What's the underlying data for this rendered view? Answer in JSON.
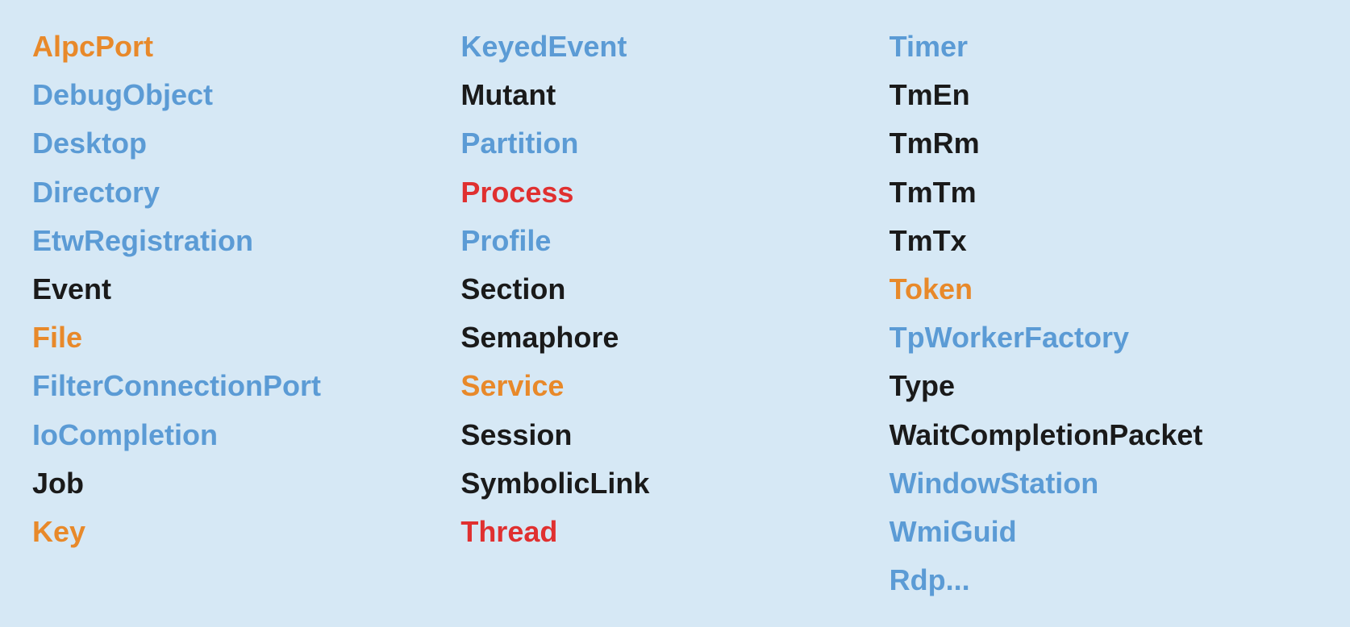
{
  "columns": [
    {
      "id": "col1",
      "items": [
        {
          "label": "AlpcPort",
          "color": "orange"
        },
        {
          "label": "DebugObject",
          "color": "blue"
        },
        {
          "label": "Desktop",
          "color": "blue"
        },
        {
          "label": "Directory",
          "color": "blue"
        },
        {
          "label": "EtwRegistration",
          "color": "blue"
        },
        {
          "label": "Event",
          "color": "black"
        },
        {
          "label": "File",
          "color": "orange"
        },
        {
          "label": "FilterConnectionPort",
          "color": "blue"
        },
        {
          "label": "IoCompletion",
          "color": "blue"
        },
        {
          "label": "Job",
          "color": "black"
        },
        {
          "label": "Key",
          "color": "orange"
        }
      ]
    },
    {
      "id": "col2",
      "items": [
        {
          "label": "KeyedEvent",
          "color": "blue"
        },
        {
          "label": "Mutant",
          "color": "black"
        },
        {
          "label": "Partition",
          "color": "blue"
        },
        {
          "label": "Process",
          "color": "red"
        },
        {
          "label": "Profile",
          "color": "blue"
        },
        {
          "label": "Section",
          "color": "black"
        },
        {
          "label": "Semaphore",
          "color": "black"
        },
        {
          "label": "Service",
          "color": "orange"
        },
        {
          "label": "Session",
          "color": "black"
        },
        {
          "label": "SymbolicLink",
          "color": "black"
        },
        {
          "label": "Thread",
          "color": "red"
        }
      ]
    },
    {
      "id": "col3",
      "items": [
        {
          "label": "Timer",
          "color": "blue"
        },
        {
          "label": "TmEn",
          "color": "black"
        },
        {
          "label": "TmRm",
          "color": "black"
        },
        {
          "label": "TmTm",
          "color": "black"
        },
        {
          "label": "TmTx",
          "color": "black"
        },
        {
          "label": "Token",
          "color": "orange"
        },
        {
          "label": "TpWorkerFactory",
          "color": "blue"
        },
        {
          "label": "Type",
          "color": "black"
        },
        {
          "label": "WaitCompletionPacket",
          "color": "black"
        },
        {
          "label": "WindowStation",
          "color": "blue"
        },
        {
          "label": "WmiGuid",
          "color": "blue"
        },
        {
          "label": "Rdp...",
          "color": "blue"
        }
      ]
    }
  ]
}
